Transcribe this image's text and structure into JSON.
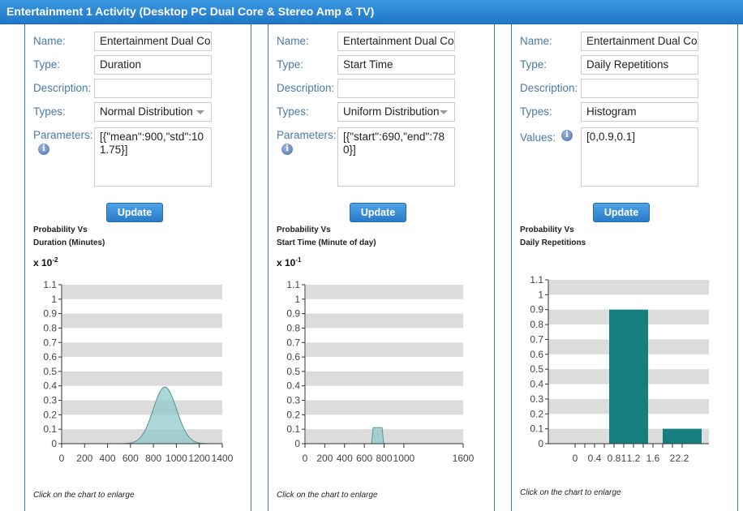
{
  "title": "Entertainment 1 Activity (Desktop PC Dual Core & Stereo Amp & TV)",
  "labels": {
    "name": "Name:",
    "type": "Type:",
    "description": "Description:",
    "types": "Types:",
    "parameters": "Parameters:",
    "values": "Values:",
    "update": "Update",
    "click_hint": "Click on the chart to enlarge",
    "info_icon": "i"
  },
  "panels": [
    {
      "name": "Entertainment Dual Core & Stereo Amp & TV",
      "type": "Duration",
      "description": "",
      "types": "Normal Distribution",
      "param_label_key": "parameters",
      "params": "[{\"mean\":900,\"std\":101.75}]",
      "chart_title1": "Probability Vs",
      "chart_title2": "Duration (Minutes)",
      "multiplier_base": "x 10",
      "multiplier_exp": "-2"
    },
    {
      "name": "Entertainment Dual Core & Stereo Amp & TV",
      "type": "Start Time",
      "description": "",
      "types": "Uniform Distribution",
      "param_label_key": "parameters",
      "params": "[{\"start\":690,\"end\":780}]",
      "chart_title1": "Probability Vs",
      "chart_title2": "Start Time (Minute of day)",
      "multiplier_base": "x 10",
      "multiplier_exp": "-1"
    },
    {
      "name": "Entertainment Dual Core & Stereo Amp & TV",
      "type": "Daily Repetitions",
      "description": "",
      "types": "Histogram",
      "param_label_key": "values",
      "params": "[0,0.9,0.1]",
      "chart_title1": "Probability Vs",
      "chart_title2": "Daily Repetitions",
      "multiplier_base": "",
      "multiplier_exp": ""
    }
  ],
  "colors": {
    "header": "#1f78c8",
    "area_fill": "#8fc9c9",
    "area_stroke": "#5f8f8f",
    "bar": "#157f80",
    "band": "#dcdcdc"
  },
  "chart_data": [
    {
      "type": "area",
      "xlim": [
        0,
        1400
      ],
      "ylim": [
        0,
        1.1
      ],
      "xticks": [
        0,
        200,
        400,
        600,
        800,
        1000,
        1200,
        1400
      ],
      "yticks": [
        0,
        0.1,
        0.2,
        0.3,
        0.4,
        0.5,
        0.6,
        0.7,
        0.8,
        0.9,
        1,
        1.1
      ],
      "distribution": "normal",
      "mean": 900,
      "std": 101.75,
      "scale": 100,
      "grid": "alternating bands"
    },
    {
      "type": "area",
      "xlim": [
        0,
        1600
      ],
      "ylim": [
        0,
        1.1
      ],
      "xticks": [
        0,
        200,
        400,
        600,
        800,
        1000,
        1600
      ],
      "yticks": [
        0,
        0.1,
        0.2,
        0.3,
        0.4,
        0.5,
        0.6,
        0.7,
        0.8,
        0.9,
        1,
        1.1
      ],
      "distribution": "uniform",
      "start": 690,
      "end": 780,
      "scale": 10,
      "grid": "alternating bands"
    },
    {
      "type": "bar",
      "xlim": [
        -0.55,
        2.75
      ],
      "ylim": [
        0,
        1.1
      ],
      "xticks": [
        0,
        0.2,
        0.4,
        0.6,
        0.8,
        1,
        1.2,
        1.4,
        1.6,
        1.8,
        2,
        2.2
      ],
      "xtick_labels": [
        "0",
        "",
        "0.4",
        "",
        "0.8",
        "1",
        "1.2",
        "",
        "1.6",
        "",
        "2",
        "2.2"
      ],
      "yticks": [
        0,
        0.1,
        0.2,
        0.3,
        0.4,
        0.5,
        0.6,
        0.7,
        0.8,
        0.9,
        1,
        1.1
      ],
      "bars": [
        {
          "x0": 0.7,
          "x1": 1.5,
          "value": 0.9
        },
        {
          "x0": 1.8,
          "x1": 2.6,
          "value": 0.1
        }
      ],
      "grid": "alternating bands"
    }
  ]
}
